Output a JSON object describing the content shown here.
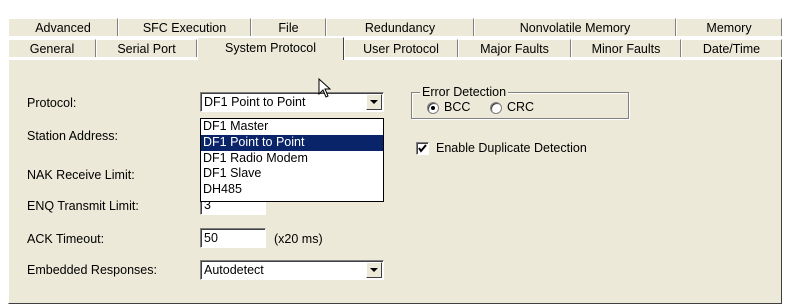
{
  "tabs_row1": [
    {
      "label": "Advanced"
    },
    {
      "label": "SFC Execution"
    },
    {
      "label": "File"
    },
    {
      "label": "Redundancy"
    },
    {
      "label": "Nonvolatile Memory"
    },
    {
      "label": "Memory"
    }
  ],
  "tabs_row2": [
    {
      "label": "General"
    },
    {
      "label": "Serial Port"
    },
    {
      "label": "System Protocol",
      "active": true
    },
    {
      "label": "User Protocol"
    },
    {
      "label": "Major Faults"
    },
    {
      "label": "Minor Faults"
    },
    {
      "label": "Date/Time"
    }
  ],
  "form": {
    "protocol_label": "Protocol:",
    "protocol_value": "DF1 Point to Point",
    "station_address_label": "Station Address:",
    "nak_label": "NAK Receive Limit:",
    "enq_label": "ENQ Transmit Limit:",
    "enq_value": "3",
    "ack_label": "ACK Timeout:",
    "ack_value": "50",
    "ack_unit": "(x20 ms)",
    "embedded_label": "Embedded Responses:",
    "embedded_value": "Autodetect"
  },
  "protocol_options": [
    {
      "label": "DF1 Master"
    },
    {
      "label": "DF1 Point to Point",
      "selected": true
    },
    {
      "label": "DF1 Radio Modem"
    },
    {
      "label": "DF1 Slave"
    },
    {
      "label": "DH485"
    }
  ],
  "error_detection": {
    "legend": "Error Detection",
    "bcc_label": "BCC",
    "crc_label": "CRC",
    "selected": "BCC"
  },
  "duplicate_detection": {
    "label": "Enable Duplicate Detection",
    "checked": true
  },
  "colors": {
    "dialog_bg": "#ece9d8",
    "selection_bg": "#0a246a",
    "selection_text": "#ffffff"
  }
}
